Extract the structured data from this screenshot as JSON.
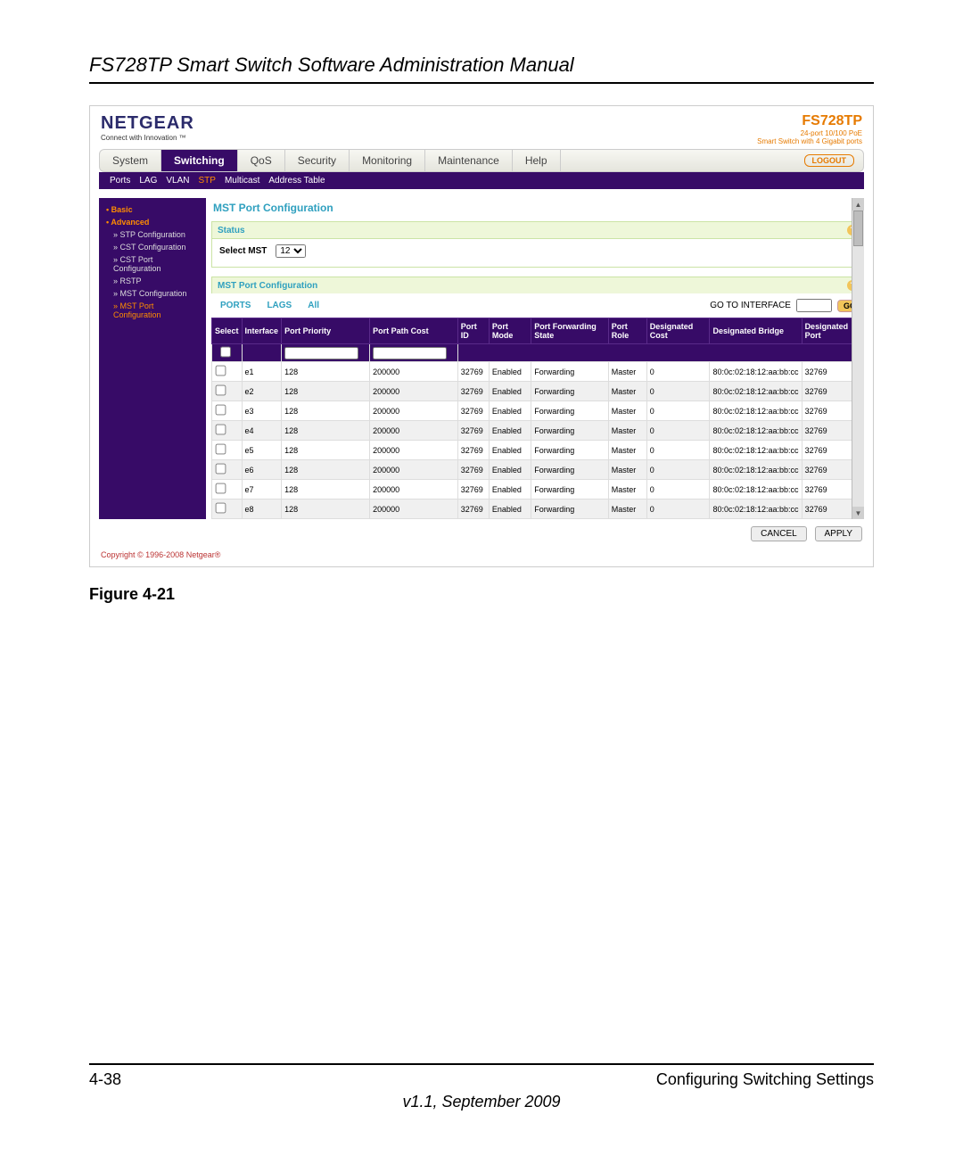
{
  "doc": {
    "title": "FS728TP Smart Switch Software Administration Manual",
    "figure": "Figure 4-21",
    "page_no": "4-38",
    "section": "Configuring Switching Settings",
    "version": "v1.1, September 2009"
  },
  "header": {
    "brand": "NETGEAR",
    "tagline": "Connect with Innovation ™",
    "model": "FS728TP",
    "model_sub1": "24-port 10/100 PoE",
    "model_sub2": "Smart Switch with 4 Gigabit ports",
    "logout": "LOGOUT"
  },
  "tabs": {
    "main": [
      "System",
      "Switching",
      "QoS",
      "Security",
      "Monitoring",
      "Maintenance",
      "Help"
    ],
    "sub": [
      "Ports",
      "LAG",
      "VLAN",
      "STP",
      "Multicast",
      "Address Table"
    ]
  },
  "sidebar": {
    "basic": "• Basic",
    "advanced": "• Advanced",
    "items": [
      "» STP Configuration",
      "» CST Configuration",
      "» CST Port Configuration",
      "» RSTP",
      "» MST Configuration",
      "» MST Port Configuration"
    ]
  },
  "panel": {
    "title": "MST Port Configuration",
    "status_label": "Status",
    "select_mst_label": "Select MST",
    "select_mst_value": "12",
    "section2": "MST Port Configuration",
    "tabs2": [
      "PORTS",
      "LAGS",
      "All"
    ],
    "goto_label": "GO TO INTERFACE",
    "go_btn": "GO"
  },
  "table": {
    "headers": [
      "Select",
      "Interface",
      "Port Priority",
      "Port Path Cost",
      "Port ID",
      "Port Mode",
      "Port Forwarding State",
      "Port Role",
      "Designated Cost",
      "Designated Bridge",
      "Designated Port"
    ],
    "rows": [
      {
        "if": "e1",
        "prio": "128",
        "cost": "200000",
        "pid": "32769",
        "mode": "Enabled",
        "fwd": "Forwarding",
        "role": "Master",
        "dcost": "0",
        "dbridge": "80:0c:02:18:12:aa:bb:cc",
        "dport": "32769"
      },
      {
        "if": "e2",
        "prio": "128",
        "cost": "200000",
        "pid": "32769",
        "mode": "Enabled",
        "fwd": "Forwarding",
        "role": "Master",
        "dcost": "0",
        "dbridge": "80:0c:02:18:12:aa:bb:cc",
        "dport": "32769"
      },
      {
        "if": "e3",
        "prio": "128",
        "cost": "200000",
        "pid": "32769",
        "mode": "Enabled",
        "fwd": "Forwarding",
        "role": "Master",
        "dcost": "0",
        "dbridge": "80:0c:02:18:12:aa:bb:cc",
        "dport": "32769"
      },
      {
        "if": "e4",
        "prio": "128",
        "cost": "200000",
        "pid": "32769",
        "mode": "Enabled",
        "fwd": "Forwarding",
        "role": "Master",
        "dcost": "0",
        "dbridge": "80:0c:02:18:12:aa:bb:cc",
        "dport": "32769"
      },
      {
        "if": "e5",
        "prio": "128",
        "cost": "200000",
        "pid": "32769",
        "mode": "Enabled",
        "fwd": "Forwarding",
        "role": "Master",
        "dcost": "0",
        "dbridge": "80:0c:02:18:12:aa:bb:cc",
        "dport": "32769"
      },
      {
        "if": "e6",
        "prio": "128",
        "cost": "200000",
        "pid": "32769",
        "mode": "Enabled",
        "fwd": "Forwarding",
        "role": "Master",
        "dcost": "0",
        "dbridge": "80:0c:02:18:12:aa:bb:cc",
        "dport": "32769"
      },
      {
        "if": "e7",
        "prio": "128",
        "cost": "200000",
        "pid": "32769",
        "mode": "Enabled",
        "fwd": "Forwarding",
        "role": "Master",
        "dcost": "0",
        "dbridge": "80:0c:02:18:12:aa:bb:cc",
        "dport": "32769"
      },
      {
        "if": "e8",
        "prio": "128",
        "cost": "200000",
        "pid": "32769",
        "mode": "Enabled",
        "fwd": "Forwarding",
        "role": "Master",
        "dcost": "0",
        "dbridge": "80:0c:02:18:12:aa:bb:cc",
        "dport": "32769"
      }
    ]
  },
  "buttons": {
    "cancel": "CANCEL",
    "apply": "APPLY"
  },
  "footer": {
    "copyright": "Copyright © 1996-2008 Netgear®"
  }
}
